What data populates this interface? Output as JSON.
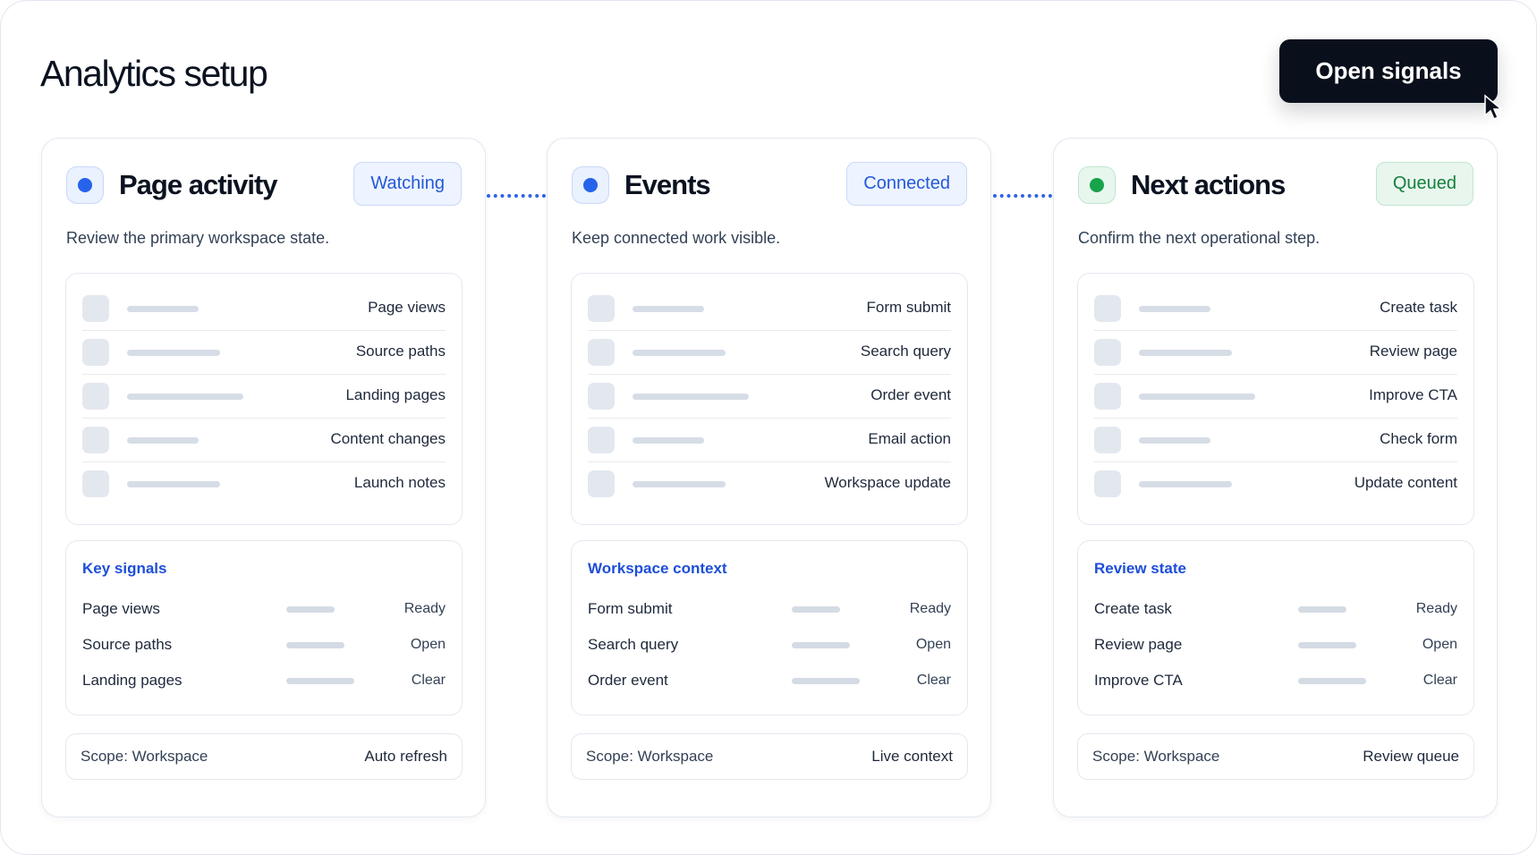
{
  "header": {
    "title": "Analytics setup",
    "open_signals_label": "Open signals"
  },
  "cards": [
    {
      "title": "Page activity",
      "badge": "Watching",
      "status_color": "#2563eb",
      "description": "Review the primary workspace state.",
      "list": [
        "Page views",
        "Source paths",
        "Landing pages",
        "Content changes",
        "Launch notes"
      ],
      "signals_title": "Key signals",
      "signals": [
        {
          "name": "Page views",
          "state": "Ready"
        },
        {
          "name": "Source paths",
          "state": "Open"
        },
        {
          "name": "Landing pages",
          "state": "Clear"
        }
      ],
      "footer_left": "Scope: Workspace",
      "footer_right": "Auto refresh"
    },
    {
      "title": "Events",
      "badge": "Connected",
      "status_color": "#2563eb",
      "description": "Keep connected work visible.",
      "list": [
        "Form submit",
        "Search query",
        "Order event",
        "Email action",
        "Workspace update"
      ],
      "signals_title": "Workspace context",
      "signals": [
        {
          "name": "Form submit",
          "state": "Ready"
        },
        {
          "name": "Search query",
          "state": "Open"
        },
        {
          "name": "Order event",
          "state": "Clear"
        }
      ],
      "footer_left": "Scope: Workspace",
      "footer_right": "Live context"
    },
    {
      "title": "Next actions",
      "badge": "Queued",
      "status_color": "#16a34a",
      "description": "Confirm the next operational step.",
      "list": [
        "Create task",
        "Review page",
        "Improve CTA",
        "Check form",
        "Update content"
      ],
      "signals_title": "Review state",
      "signals": [
        {
          "name": "Create task",
          "state": "Ready"
        },
        {
          "name": "Review page",
          "state": "Open"
        },
        {
          "name": "Improve CTA",
          "state": "Clear"
        }
      ],
      "footer_left": "Scope: Workspace",
      "footer_right": "Review queue"
    }
  ],
  "icons": {
    "cursor": "mouse-pointer-icon",
    "status": "status-dot-icon"
  },
  "colors": {
    "accent_blue": "#2563eb",
    "accent_green": "#16a34a",
    "button_dark": "#0a0f1c"
  }
}
